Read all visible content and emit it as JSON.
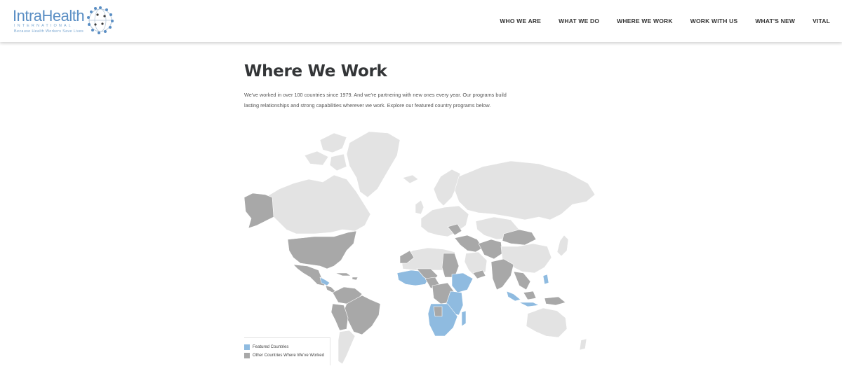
{
  "header": {
    "logo": {
      "name": "IntraHealth",
      "subtitle": "INTERNATIONAL",
      "tagline": "Because Health Workers Save Lives"
    },
    "nav": [
      "WHO WE ARE",
      "WHAT WE DO",
      "WHERE WE WORK",
      "WORK WITH US",
      "WHAT'S NEW",
      "VITAL"
    ]
  },
  "page": {
    "title": "Where We Work",
    "intro": "We've worked in over 100 countries since 1979. And we're partnering with new ones every year. Our programs build lasting relationships and strong capabilities wherever we work. Explore our featured country programs below."
  },
  "legend": {
    "featured_label": "Featured Countries",
    "other_label": "Other Countries Where We've Worked"
  },
  "colors": {
    "featured": "#8fbbe0",
    "other": "#a8a8a8",
    "land": "#e3e3e3",
    "border": "#ffffff"
  }
}
